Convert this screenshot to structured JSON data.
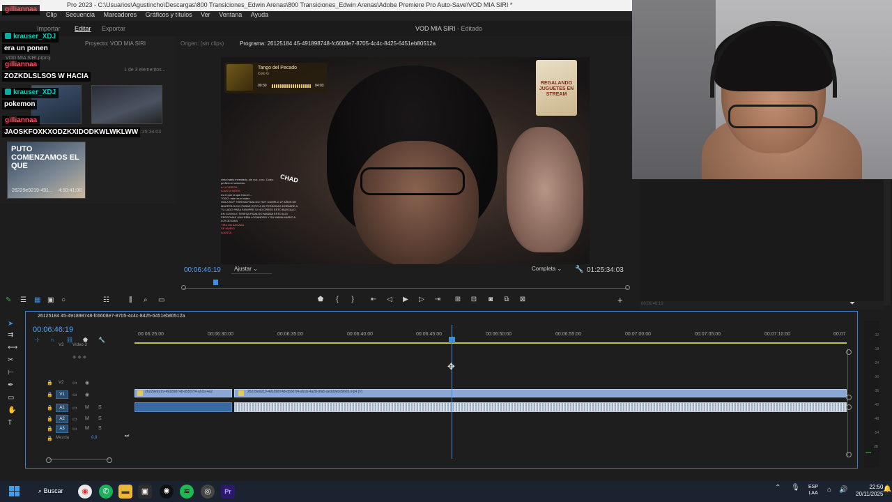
{
  "window": {
    "title": "Pro 2023 - C:\\Usuarios\\Agustincho\\Descargas\\800 Transiciones_Edwin Arenas\\800 Transiciones_Edwin Arenas\\Adobe Premiere Pro Auto-Save\\VOD MIA SIRI *",
    "document_title": "VOD MIA SIRI",
    "document_status": "- Editado"
  },
  "menu": {
    "items": [
      "Clip",
      "Secuencia",
      "Marcadores",
      "Gráficos y títulos",
      "Ver",
      "Ventana",
      "Ayuda"
    ]
  },
  "workspaces": {
    "import": "Importar",
    "edit": "Editar",
    "export": "Exportar"
  },
  "project_panel": {
    "tab": "Proyecto: VOD MIA SIRI",
    "folder": "VOD MIA SIRI.prproj",
    "items_count": "1 de 3 elementos...",
    "clip_label": "26229e9219-491...",
    "clip_duration": "4:50:41:08",
    "clip2_duration": "1:25:34:03",
    "overlay_text": "PUTO COMENZAMOS EL QUE"
  },
  "chat_overlay": [
    {
      "user": "gilliannaa",
      "color": "#ff4f5e",
      "badge": false
    },
    {
      "user": "krauser_XDJ",
      "color": "#00d0c0",
      "badge": true,
      "message": "era un ponen"
    },
    {
      "user": "gilliannaa",
      "color": "#ff4f5e",
      "badge": false,
      "message": "ZOZKDLSLSOS W HACIA"
    },
    {
      "user": "krauser_XDJ",
      "color": "#00d0c0",
      "badge": true,
      "message": "pokemon"
    },
    {
      "user": "gilliannaa",
      "color": "#ff4f5e",
      "badge": false,
      "message": "JAOSKFOXKXODZKXIDODKWLWKLWW"
    }
  ],
  "source_monitor": {
    "tab": "Origen: (sin clips)"
  },
  "program_monitor": {
    "tab": "Programa: 26125184 45-491898748-fc6608e7-8705-4c4c-8425-6451eb80512a",
    "timecode_current": "00:06:46:19",
    "fit": "Ajustar",
    "quality": "Completa",
    "timecode_duration": "01:25:34:03"
  },
  "video_overlay": {
    "song_title": "Tango del Pecado",
    "song_artist": "Coto G",
    "song_time_elapsed": "00:30",
    "song_time_total": "04:03",
    "promo_text": "REGALANDO JUGUETES EN STREAM",
    "chad_label": "CHAD",
    "stream_chat": [
      "cinta hablo inventado. sin voz, o no. Colec.",
      "prefiero el universo.",
      "A LA VERGA",
      "AJUSTA NOOS",
      "es el que la que hizo el ...",
      "TODO: este es el video",
      "HOLA SOY TERESA FIDALGO HOY CUMPLO 27 AÑOS DE MUERTA SI NO PASAS ESTO A 20 PERSONAS DORMIRE A TU LADO PARA SIEMPRE SI NO CREES ESTO BUSCALO EN GOOGLE TERESA FIDALGO MANDA ESTO A 20 PERSONAS UNA NIÑA LOGANDRO Y SU MAMA MURIO A LOS 30 DIAS",
      "TIRA UN AAGAAA",
      "SE MURIO",
      "AJUSTA"
    ]
  },
  "timeline": {
    "sequence_tab": "26125184 45-491898748-fc6608e7-8705-4c4c-8425-6451eb80512a",
    "timecode": "00:06:46:19",
    "ruler_labels": [
      "00:06:25:00",
      "00:06:30:00",
      "00:06:35:00",
      "00:06:40:00",
      "00:06:45:00",
      "00:06:50:00",
      "00:06:55:00",
      "00:07:00:00",
      "00:07:05:00",
      "00:07:10:00",
      "00:07"
    ],
    "tracks": {
      "v3": "V3",
      "video3_label": "Vídeo 3",
      "v2": "V2",
      "v1": "V1",
      "a1": "A1",
      "a2": "A2",
      "a3": "A3",
      "mix": "Mezcla",
      "mix_value": "0,0"
    },
    "clip_a_label": "26229e9219-491898748-d5507f4-a51b-4a2",
    "clip_b_label": "26229e9219-491898748-d5507f4-a51b-4a28-9fa5-ae3d0e0d9b05.mp4 [V]",
    "track_controls": {
      "video": [
        "👁",
        "⟷"
      ],
      "audio": [
        "M",
        "S"
      ]
    }
  },
  "meter": {
    "labels": [
      "-12",
      "-18",
      "-24",
      "-30",
      "-36",
      "-42",
      "-48",
      "-54",
      "dB"
    ]
  },
  "taskbar": {
    "search": "Buscar",
    "language_line1": "ESP",
    "language_line2": "LAA",
    "time": "22:50",
    "date": "20/11/2025"
  },
  "side": {
    "timecode": "00:06:46:19"
  },
  "colors": {
    "accent_blue": "#3f8edf",
    "timecode_blue": "#4ea3ff",
    "work_area": "#c2c24b",
    "clip_video": "#8aa7d6",
    "clip_audio": "#3a6aa2"
  },
  "icons": [
    "play-icon",
    "step-back-icon",
    "step-forward-icon",
    "marker-icon",
    "camera-icon",
    "wrench-icon",
    "add-icon",
    "selection-tool-icon",
    "razor-tool-icon",
    "hand-tool-icon",
    "type-tool-icon",
    "pen-tool-icon",
    "filter-icon"
  ]
}
